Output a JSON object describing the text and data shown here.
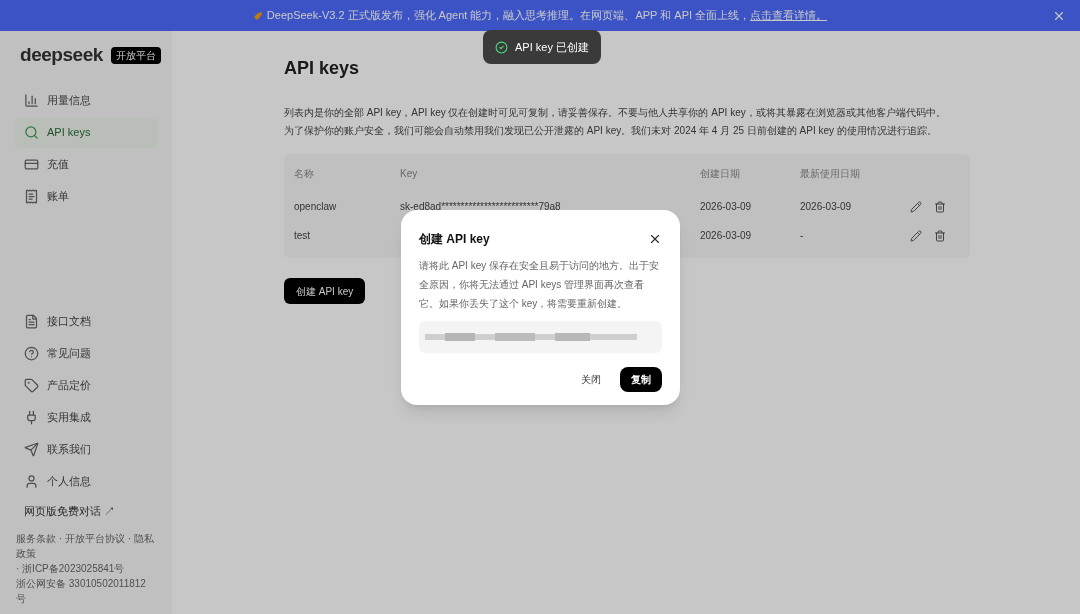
{
  "banner": {
    "text": "DeepSeek-V3.2 正式版发布，强化 Agent 能力，融入思考推理。在网页端、APP 和 API 全面上线，",
    "link": "点击查看详情。"
  },
  "brand": {
    "logo": "deepseek",
    "badge": "开放平台"
  },
  "sidebar": {
    "top_items": [
      {
        "label": "用量信息",
        "selected": false
      },
      {
        "label": "API keys",
        "selected": true
      },
      {
        "label": "充值",
        "selected": false
      },
      {
        "label": "账单",
        "selected": false
      }
    ],
    "bottom_items": [
      {
        "label": "接口文档"
      },
      {
        "label": "常见问题"
      },
      {
        "label": "产品定价"
      },
      {
        "label": "实用集成"
      },
      {
        "label": "联系我们"
      },
      {
        "label": "个人信息"
      }
    ],
    "chat_link": "网页版免费对话 ↗",
    "footer": [
      "服务条款 · 开放平台协议 · 隐私政策",
      "· 浙ICP备2023025841号",
      "浙公网安备 33010502011812 号"
    ]
  },
  "page": {
    "title": "API keys",
    "description": [
      "列表内是你的全部 API key，API key 仅在创建时可见可复制，请妥善保存。不要与他人共享你的 API key，或将其暴露在浏览器或其他客户端代码中。",
      "为了保护你的账户安全，我们可能会自动禁用我们发现已公开泄露的 API key。我们未对 2024 年 4 月 25 日前创建的 API key 的使用情况进行追踪。"
    ],
    "table": {
      "columns": [
        "名称",
        "Key",
        "创建日期",
        "最新使用日期"
      ],
      "rows": [
        {
          "name": "openclaw",
          "key": "sk-ed8ad*************************79a8",
          "created": "2026-03-09",
          "last_used": "2026-03-09"
        },
        {
          "name": "test",
          "created": "2026-03-09",
          "last_used": "-"
        }
      ]
    },
    "create_button": "创建 API key"
  },
  "toast": {
    "text": "API key 已创建"
  },
  "dialog": {
    "title": "创建 API key",
    "body": "请将此 API key 保存在安全且易于访问的地方。出于安全原因，你将无法通过 API keys 管理界面再次查看它。如果你丢失了这个 key，将需要重新创建。",
    "buttons": [
      {
        "label": "关闭",
        "kind": "text"
      },
      {
        "label": "复制",
        "kind": "primary"
      }
    ]
  }
}
